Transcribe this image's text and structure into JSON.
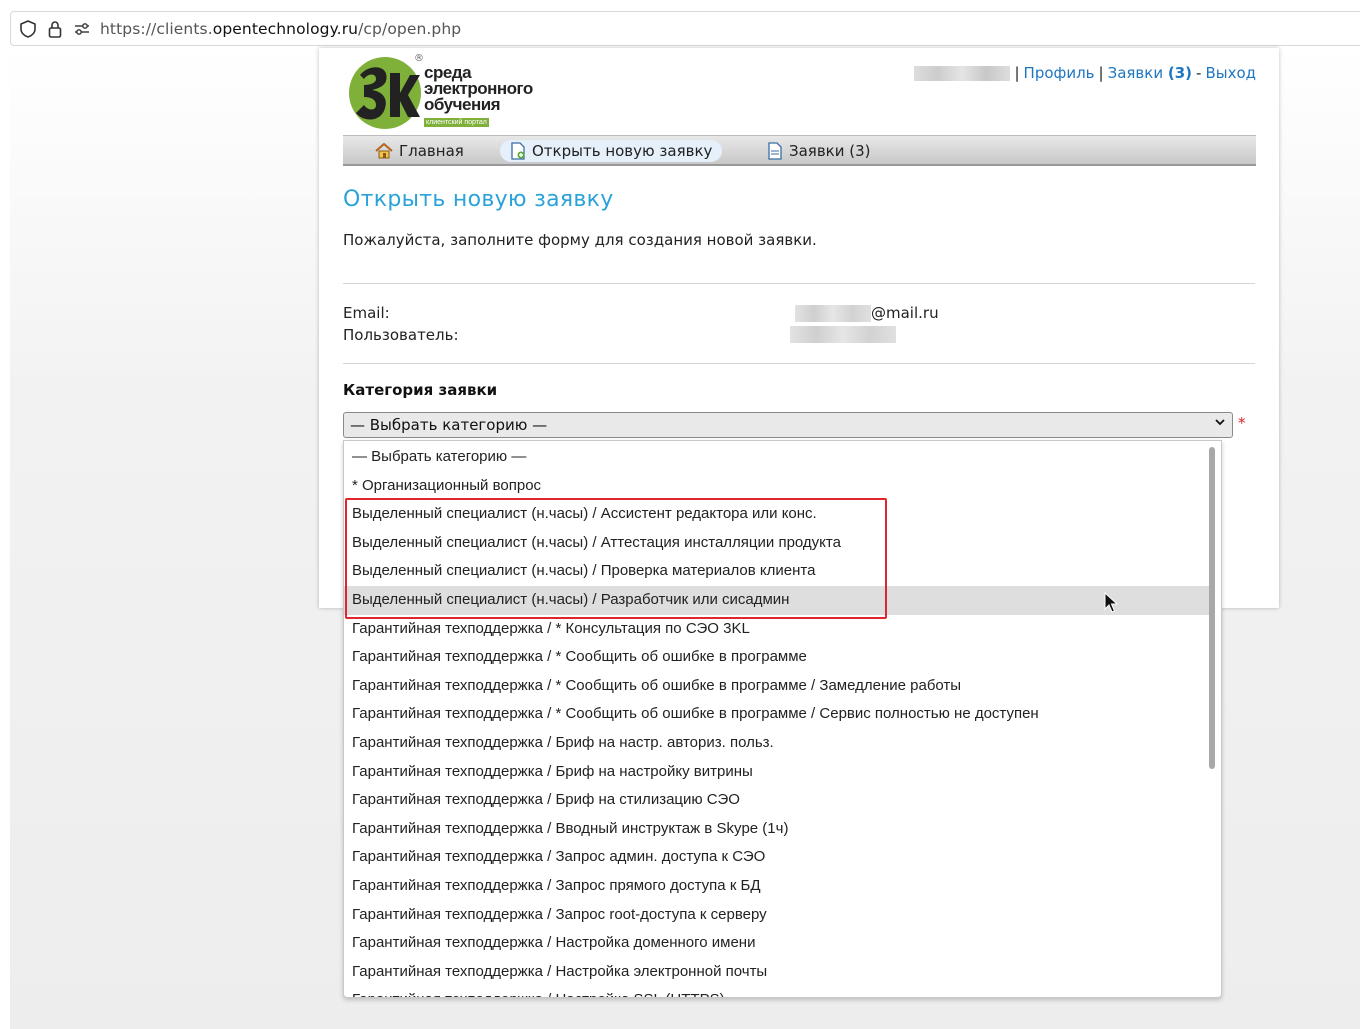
{
  "browser": {
    "url_prefix": "https://clients.",
    "url_domain": "opentechnology.ru",
    "url_path": "/cp/open.php"
  },
  "logo": {
    "line1": "среда",
    "line2": "электронного",
    "line3": "обучения",
    "tag": "клиентский портал",
    "registered": "®"
  },
  "header": {
    "sep1": "|",
    "profile": "Профиль",
    "sep2": "|",
    "tickets": "Заявки",
    "tickets_count": "(3)",
    "sep3": "-",
    "logout": "Выход"
  },
  "nav": {
    "home": "Главная",
    "open_new": "Открыть новую заявку",
    "tickets": "Заявки (3)"
  },
  "page": {
    "title": "Открыть новую заявку",
    "intro": "Пожалуйста, заполните форму для создания новой заявки.",
    "email_label": "Email:",
    "email_suffix": "@mail.ru",
    "user_label": "Пользователь:",
    "category_title": "Категория заявки",
    "required_mark": "*"
  },
  "select": {
    "selected": "— Выбрать категорию —",
    "options": [
      "— Выбрать категорию —",
      "* Организационный вопрос",
      "Выделенный специалист (н.часы) / Ассистент редактора или конс.",
      "Выделенный специалист (н.часы) / Аттестация инсталляции продукта",
      "Выделенный специалист (н.часы) / Проверка материалов клиента",
      "Выделенный специалист (н.часы) / Разработчик или сисадмин",
      "Гарантийная техподдержка / * Консультация по СЭО 3KL",
      "Гарантийная техподдержка / * Сообщить об ошибке в программе",
      "Гарантийная техподдержка / * Сообщить об ошибке в программе / Замедление работы",
      "Гарантийная техподдержка / * Сообщить об ошибке в программе / Сервис полностью не доступен",
      "Гарантийная техподдержка / Бриф на настр. авториз. польз.",
      "Гарантийная техподдержка / Бриф на настройку витрины",
      "Гарантийная техподдержка / Бриф на стилизацию СЭО",
      "Гарантийная техподдержка / Вводный инструктаж в Skype (1ч)",
      "Гарантийная техподдержка / Запрос админ. доступа к СЭО",
      "Гарантийная техподдержка / Запрос прямого доступа к БД",
      "Гарантийная техподдержка / Запрос root-доступа к серверу",
      "Гарантийная техподдержка / Настройка доменного имени",
      "Гарантийная техподдержка / Настройка электронной почты",
      "Гарантийная техподдержка / Настройка SSL (HTTPS)"
    ],
    "hovered_index": 5
  },
  "colors": {
    "link": "#1f76c0",
    "title": "#2aa3d8",
    "highlight": "#e0252b",
    "logo_green": "#7fb03a"
  }
}
